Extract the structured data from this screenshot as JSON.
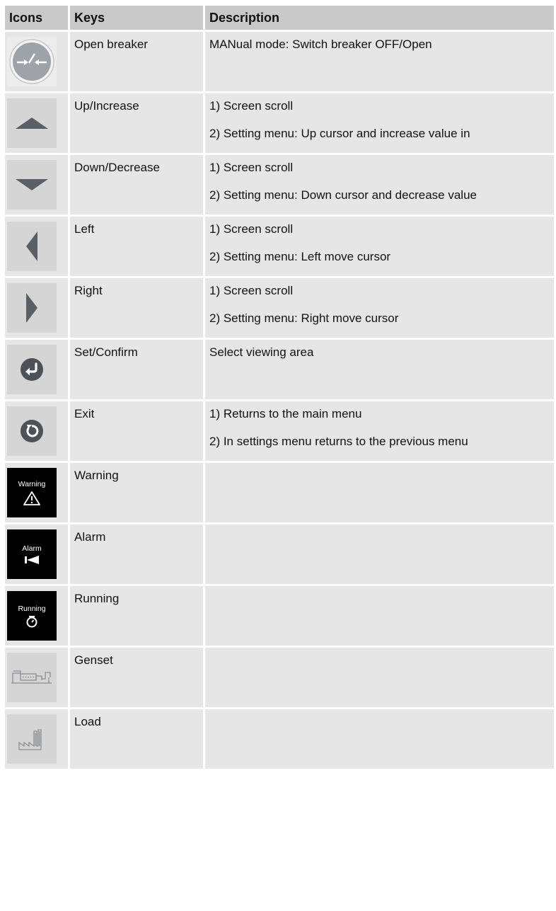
{
  "header": {
    "icons": "Icons",
    "keys": "Keys",
    "description": "Description"
  },
  "rows": [
    {
      "icon": "open-breaker-icon",
      "key": "Open breaker",
      "desc": [
        "MANual mode: Switch breaker OFF/Open"
      ]
    },
    {
      "icon": "up-arrow-icon",
      "key": "Up/Increase",
      "desc": [
        "1) Screen scroll",
        "2) Setting menu: Up cursor and increase value in"
      ]
    },
    {
      "icon": "down-arrow-icon",
      "key": "Down/Decrease",
      "desc": [
        "1) Screen scroll",
        "2) Setting menu: Down cursor and decrease value"
      ]
    },
    {
      "icon": "left-arrow-icon",
      "key": "Left",
      "desc": [
        "1) Screen scroll",
        "2) Setting menu: Left move cursor"
      ]
    },
    {
      "icon": "right-arrow-icon",
      "key": "Right",
      "desc": [
        "1) Screen scroll",
        "2) Setting menu: Right move cursor"
      ]
    },
    {
      "icon": "enter-icon",
      "key": "Set/Confirm",
      "desc": [
        "Select viewing area"
      ]
    },
    {
      "icon": "exit-icon",
      "key": "Exit",
      "desc": [
        "1) Returns to the main menu",
        "2) In settings menu returns to the previous menu"
      ]
    },
    {
      "icon": "warning-icon",
      "icon_label": "Warning",
      "key": "Warning",
      "desc": []
    },
    {
      "icon": "alarm-icon",
      "icon_label": "Alarm",
      "key": "Alarm",
      "desc": []
    },
    {
      "icon": "running-icon",
      "icon_label": "Running",
      "key": "Running",
      "desc": []
    },
    {
      "icon": "genset-icon",
      "key": "Genset",
      "desc": []
    },
    {
      "icon": "load-icon",
      "key": "Load",
      "desc": []
    }
  ]
}
